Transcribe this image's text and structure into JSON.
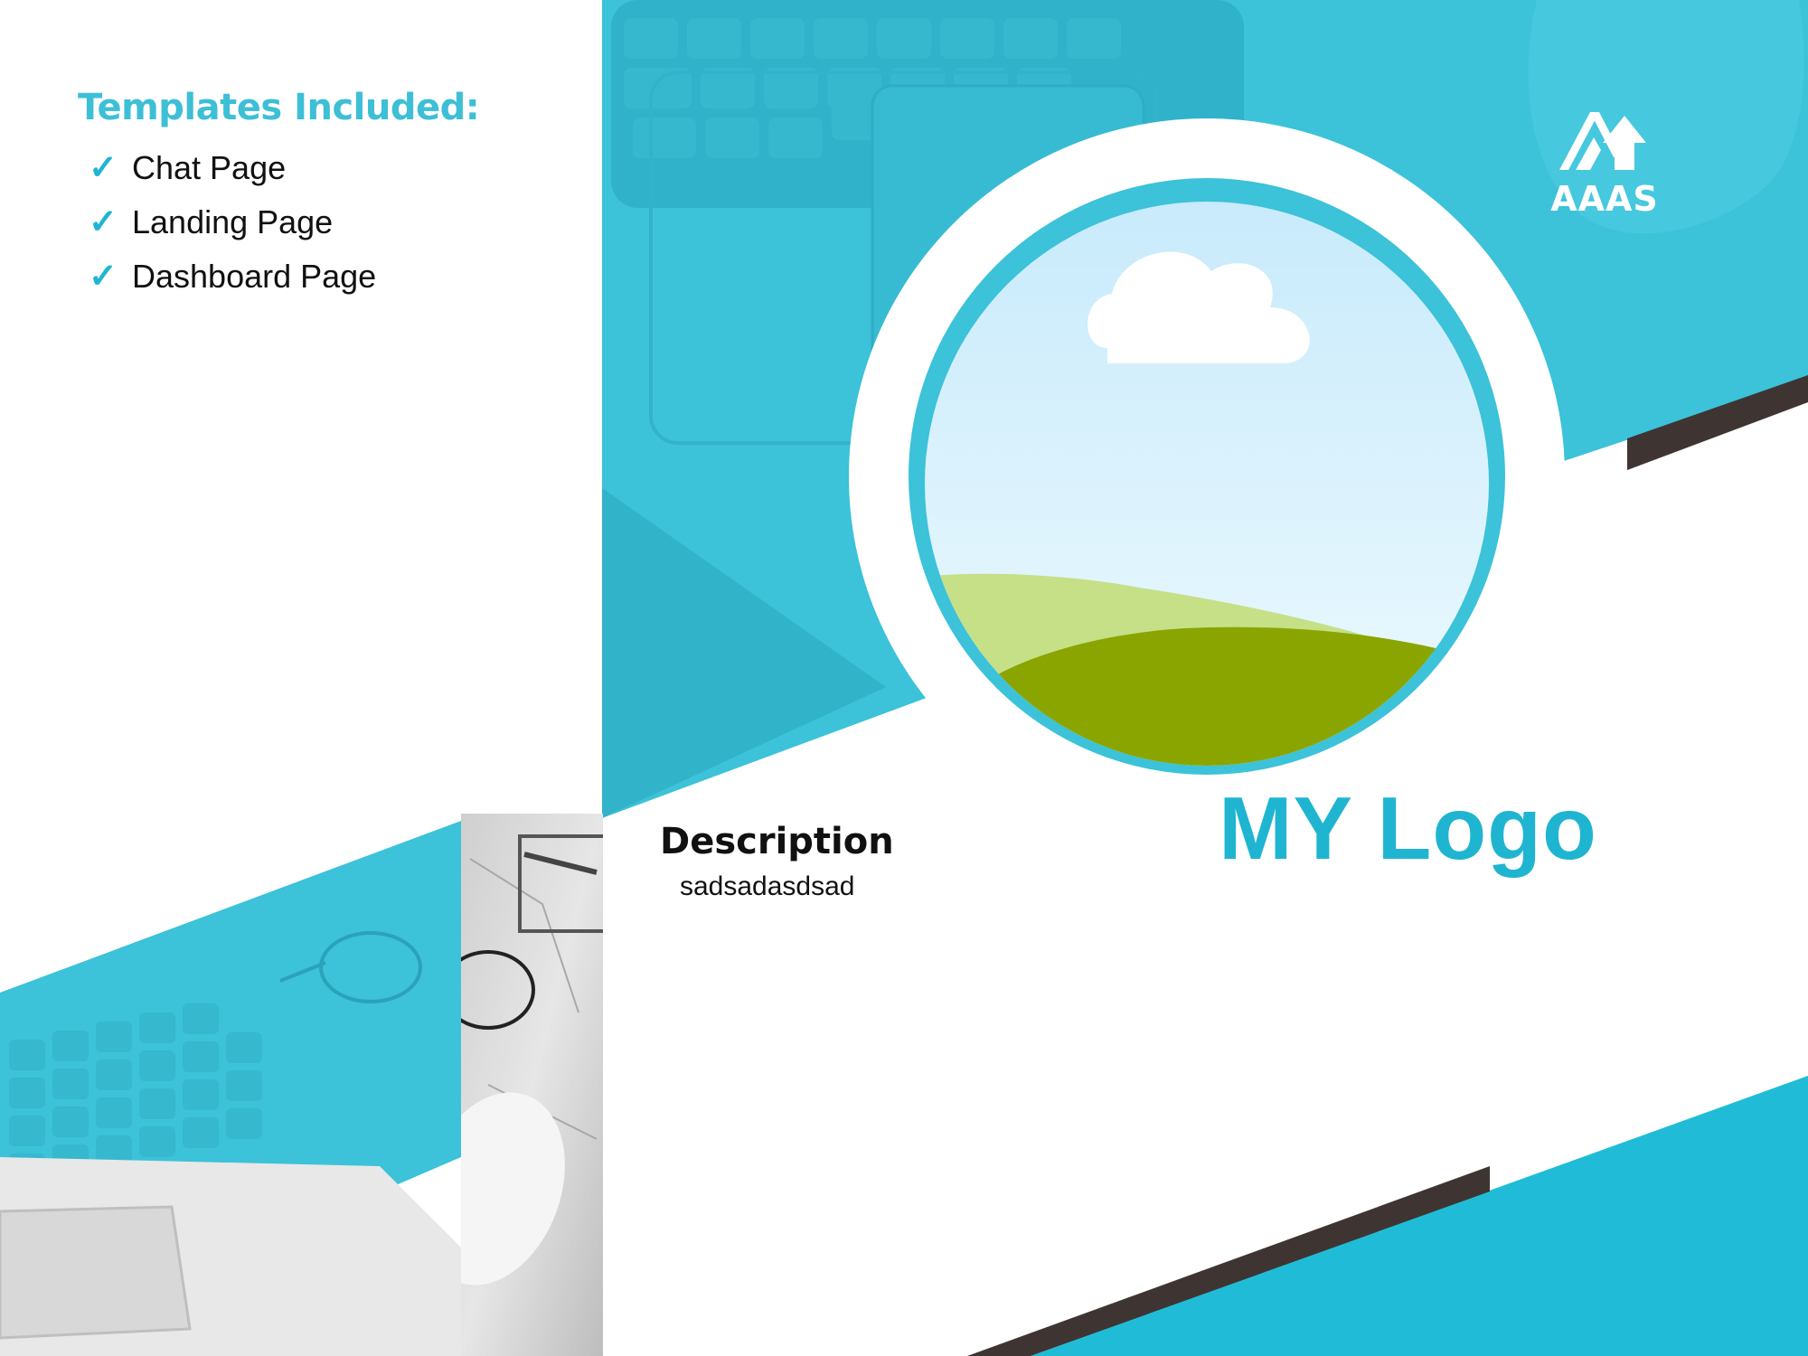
{
  "templates": {
    "title": "Templates Included:",
    "items": [
      "Chat Page",
      "Landing Page",
      "Dashboard Page"
    ],
    "check_icon": "✓"
  },
  "brand": {
    "name": "AAAS",
    "icon": "mountain-arrow-logo"
  },
  "description": {
    "title": "Description",
    "text": "sadsadasdsad"
  },
  "main_title": "MY Logo",
  "colors": {
    "accent": "#1fb5d1",
    "accent_light": "#3dc3da",
    "dark_stripe": "#3e3532",
    "white": "#ffffff",
    "grass_dark": "#8aa500",
    "grass_light": "#c5e087",
    "sky_top": "#c7eafb"
  }
}
